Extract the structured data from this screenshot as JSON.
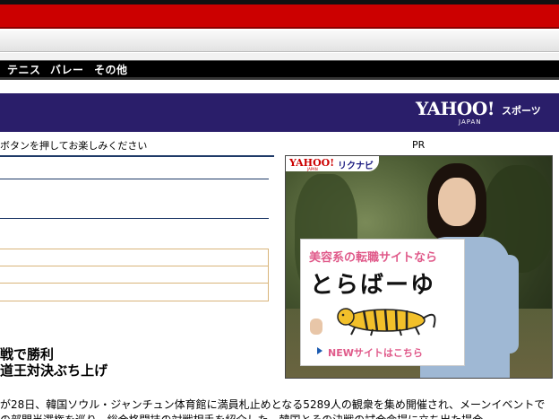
{
  "nav": {
    "items": [
      "テニス",
      "バレー",
      "その他"
    ]
  },
  "brand": {
    "logo_text": "YAHOO!",
    "logo_sub": "JAPAN",
    "section": "スポーツ"
  },
  "instruction_text": "ボタンを押してお楽しみください",
  "pr_label": "PR",
  "ad": {
    "brand_logo": "YAHOO!",
    "brand_logo_sub": "JAPAN",
    "brand_service": "リクナビ",
    "sign_line1": "美容系の転職サイトなら",
    "sign_line2": "とらばーゆ",
    "cta": "NEWサイトはこちら"
  },
  "article": {
    "headline_line1": "戦で勝利",
    "headline_line2": "道王対決ぶち上げ",
    "body_line1": "が28日、韓国ソウル・ジャンチュン体育館に満員札止めとなる5289人の観衆を集め開催され、メーンイベントで",
    "body_line2": "の部門当選権を巡り、総合格闘技の対戦相手を紹介した。韓国とその決戦の試合会場に立ち出た場合"
  },
  "colors": {
    "top_red": "#cc0000",
    "yahoo_band": "#2a1e6a",
    "nav_bg": "#000000",
    "panel_border": "#d9b47a",
    "rule_blue": "#1f3a68",
    "ad_pink": "#e05a8a"
  }
}
